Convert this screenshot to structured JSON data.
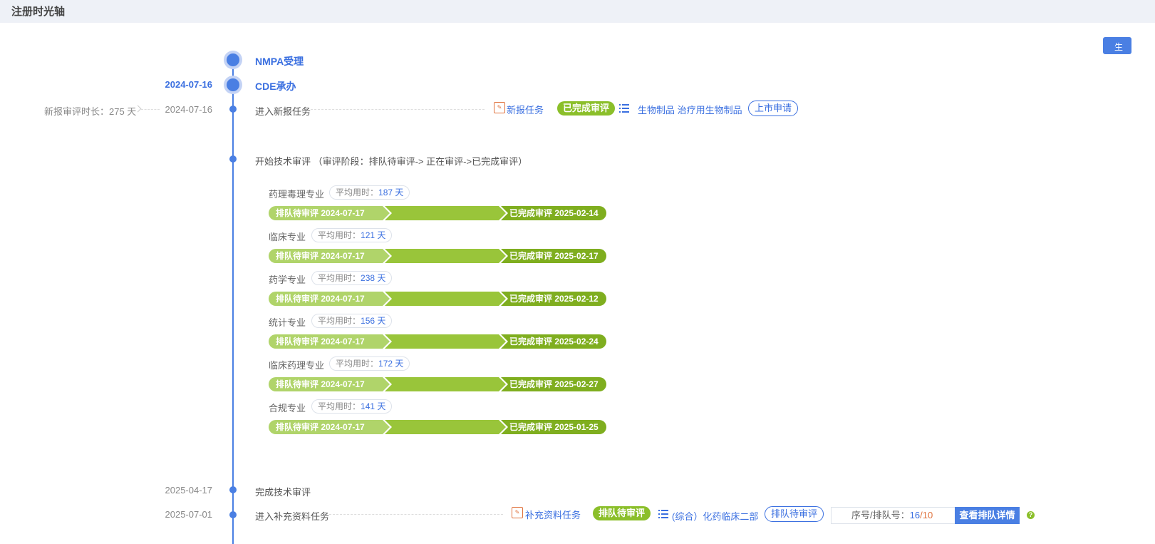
{
  "header": {
    "title": "注册时光轴"
  },
  "side_button": {
    "label": "生"
  },
  "stages": {
    "nmpa": {
      "title": "NMPA受理"
    },
    "cde": {
      "title": "CDE承办",
      "date": "2024-07-16"
    }
  },
  "new_report": {
    "duration_label": "新报审评时长：275 天",
    "date": "2024-07-16",
    "event": "进入新报任务",
    "task_label": "新报任务",
    "status": "已完成审评",
    "category": "生物制品 治疗用生物制品",
    "application_type": "上市申请"
  },
  "tech_review": {
    "event": "开始技术审评 （审评阶段：排队待审评-> 正在审评->已完成审评）",
    "specialties": [
      {
        "name": "药理毒理专业",
        "avg": "平均用时：",
        "days": "187 天",
        "start_label": "排队待审评  2024-07-17",
        "end_label": "已完成审评  2025-02-14"
      },
      {
        "name": "临床专业",
        "avg": "平均用时：",
        "days": "121 天",
        "start_label": "排队待审评  2024-07-17",
        "end_label": "已完成审评  2025-02-17"
      },
      {
        "name": "药学专业",
        "avg": "平均用时：",
        "days": "238 天",
        "start_label": "排队待审评  2024-07-17",
        "end_label": "已完成审评  2025-02-12"
      },
      {
        "name": "统计专业",
        "avg": "平均用时：",
        "days": "156 天",
        "start_label": "排队待审评  2024-07-17",
        "end_label": "已完成审评  2025-02-24"
      },
      {
        "name": "临床药理专业",
        "avg": "平均用时：",
        "days": "172 天",
        "start_label": "排队待审评  2024-07-17",
        "end_label": "已完成审评  2025-02-27"
      },
      {
        "name": "合规专业",
        "avg": "平均用时：",
        "days": "141 天",
        "start_label": "排队待审评  2024-07-17",
        "end_label": "已完成审评  2025-01-25"
      }
    ]
  },
  "tech_done": {
    "date": "2025-04-17",
    "event": "完成技术审评"
  },
  "supplement": {
    "date": "2025-07-01",
    "event": "进入补充资料任务",
    "task_label": "补充资料任务",
    "status": "排队待审评",
    "department": "(综合）化药临床二部",
    "outline_status": "排队待审评",
    "queue_label": "序号/排队号：",
    "queue_num": "16",
    "queue_sep": "/",
    "queue_den": "10",
    "queue_button": "查看排队详情",
    "help": "?"
  },
  "icons": {
    "task": "task-doc-icon",
    "list": "list-icon",
    "help": "help-icon"
  },
  "colors": {
    "accent": "#4a7fe3",
    "green": "#8bbf2a",
    "orange": "#e0733e"
  }
}
